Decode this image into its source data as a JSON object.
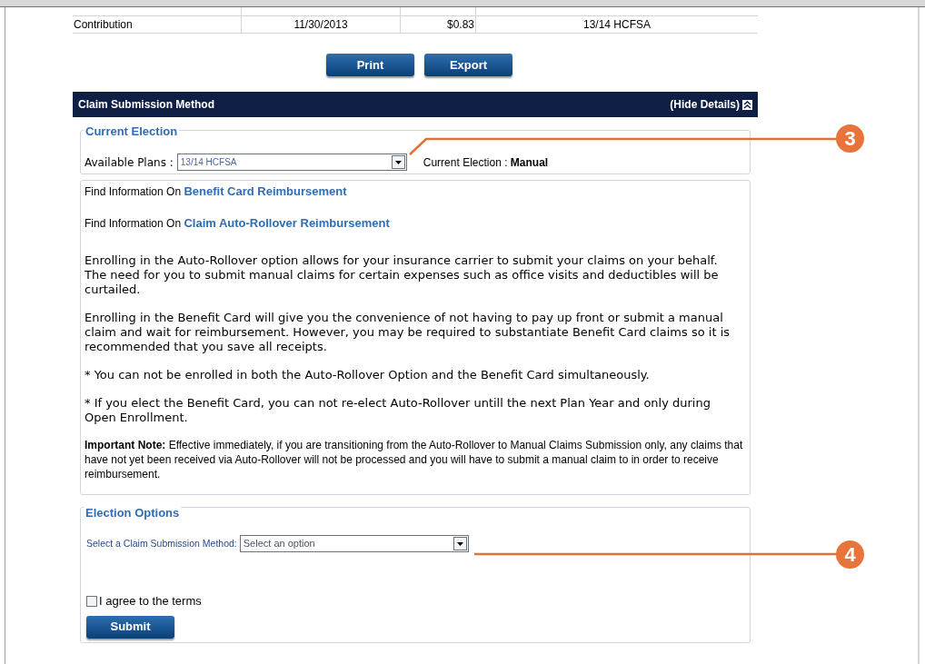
{
  "table": {
    "rows": [
      {
        "cells": [
          "Contribution",
          "11/30/2013",
          "$0.83",
          "13/14 HCFSA"
        ]
      }
    ]
  },
  "buttons": [
    "Print",
    "Export"
  ],
  "panel": {
    "title": "Claim Submission Method",
    "toggle": "(Hide Details)",
    "expanded": true
  },
  "current_election": {
    "legend": "Current Election",
    "plans_label": "Available Plans :",
    "plans_value": "13/14 HCFSA",
    "election_label": "Current Election :",
    "election_value": "Manual"
  },
  "info": {
    "links": [
      {
        "prefix": "Find Information On",
        "link": "Benefit Card Reimbursement"
      },
      {
        "prefix": "Find Information On",
        "link": "Claim Auto-Rollover Reimbursement"
      }
    ],
    "paragraphs": [
      "Enrolling in the Auto-Rollover option allows for your insurance carrier to submit your claims on your behalf. The need for you to submit manual claims for certain expenses such as office visits and deductibles will be curtailed.",
      "Enrolling in the Benefit Card will give you the convenience of not having to pay up front or submit a manual claim and wait for reimbursement. However, you may be required to substantiate Benefit Card claims so it is recommended that you save all receipts.",
      "* You can not be enrolled in both the Auto-Rollover Option and the Benefit Card simultaneously.",
      "* If you elect the Benefit Card, you can not re-elect Auto-Rollover untill the next Plan Year and only during Open Enrollment."
    ],
    "note": "**Important Note:** Effective immediately, if you are transitioning from the Auto-Rollover to Manual Claims Submission only, any claims that have not yet been received via Auto-Rollover will not be processed and you will have to submit a manual claim to in order to receive reimbursement."
  },
  "election_options": {
    "legend": "Election Options",
    "method_label": "Select a Claim Submission Method:",
    "method_placeholder": "Select an option",
    "agree_label": "I agree to the terms",
    "agree_checked": false,
    "submit": "Submit"
  },
  "callouts": [
    "3",
    "4"
  ]
}
